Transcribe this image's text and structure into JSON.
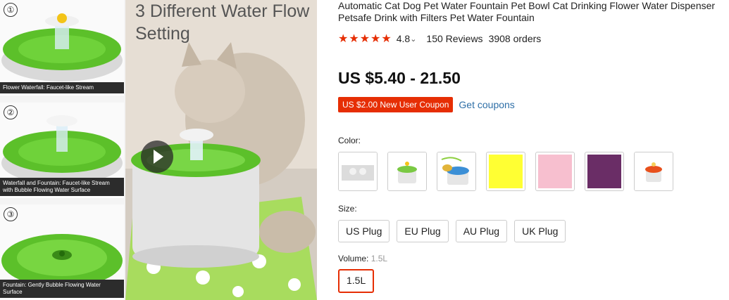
{
  "gallery": {
    "thumbs": [
      {
        "number": "①",
        "caption": "Flower Waterfall: Faucet-like Stream"
      },
      {
        "number": "②",
        "caption": "Waterfall and Fountain: Faucet-like Stream with Bubble Flowing Water Surface"
      },
      {
        "number": "③",
        "caption": "Fountain: Gently Bubble Flowing Water Surface"
      }
    ],
    "headline": "3 Different Water Flow Setting"
  },
  "product": {
    "title": "Automatic Cat Dog Pet Water Fountain Pet Bowl Cat Drinking Flower Water Dispenser Petsafe Drink with Filters Pet Water Fountain",
    "stars": "★★★★★",
    "rating": "4.8",
    "rating_caret": "⌄",
    "reviews": "150 Reviews",
    "orders": "3908 orders",
    "price": "US $5.40 - 21.50",
    "coupon": "US $2.00 New User Coupon",
    "get_coupons": "Get coupons"
  },
  "color": {
    "label": "Color:",
    "swatches": [
      {
        "name": "filter-accessory",
        "color": "#dcdcdc"
      },
      {
        "name": "green-fountain",
        "color": "#7ac943"
      },
      {
        "name": "blue-fountain-with-cat",
        "color": "#3b8fd6"
      },
      {
        "name": "yellow",
        "color": "#ffff33"
      },
      {
        "name": "pink",
        "color": "#f7bfcf"
      },
      {
        "name": "purple",
        "color": "#6a2d66"
      },
      {
        "name": "orange-fountain",
        "color": "#e8501c"
      }
    ]
  },
  "size": {
    "label": "Size:",
    "options": [
      "US Plug",
      "EU Plug",
      "AU Plug",
      "UK Plug"
    ]
  },
  "volume": {
    "label": "Volume:",
    "selected_value": "1.5L",
    "options": [
      "1.5L"
    ]
  },
  "colors": {
    "accent": "#e62e04",
    "link": "#2e6fa7"
  }
}
